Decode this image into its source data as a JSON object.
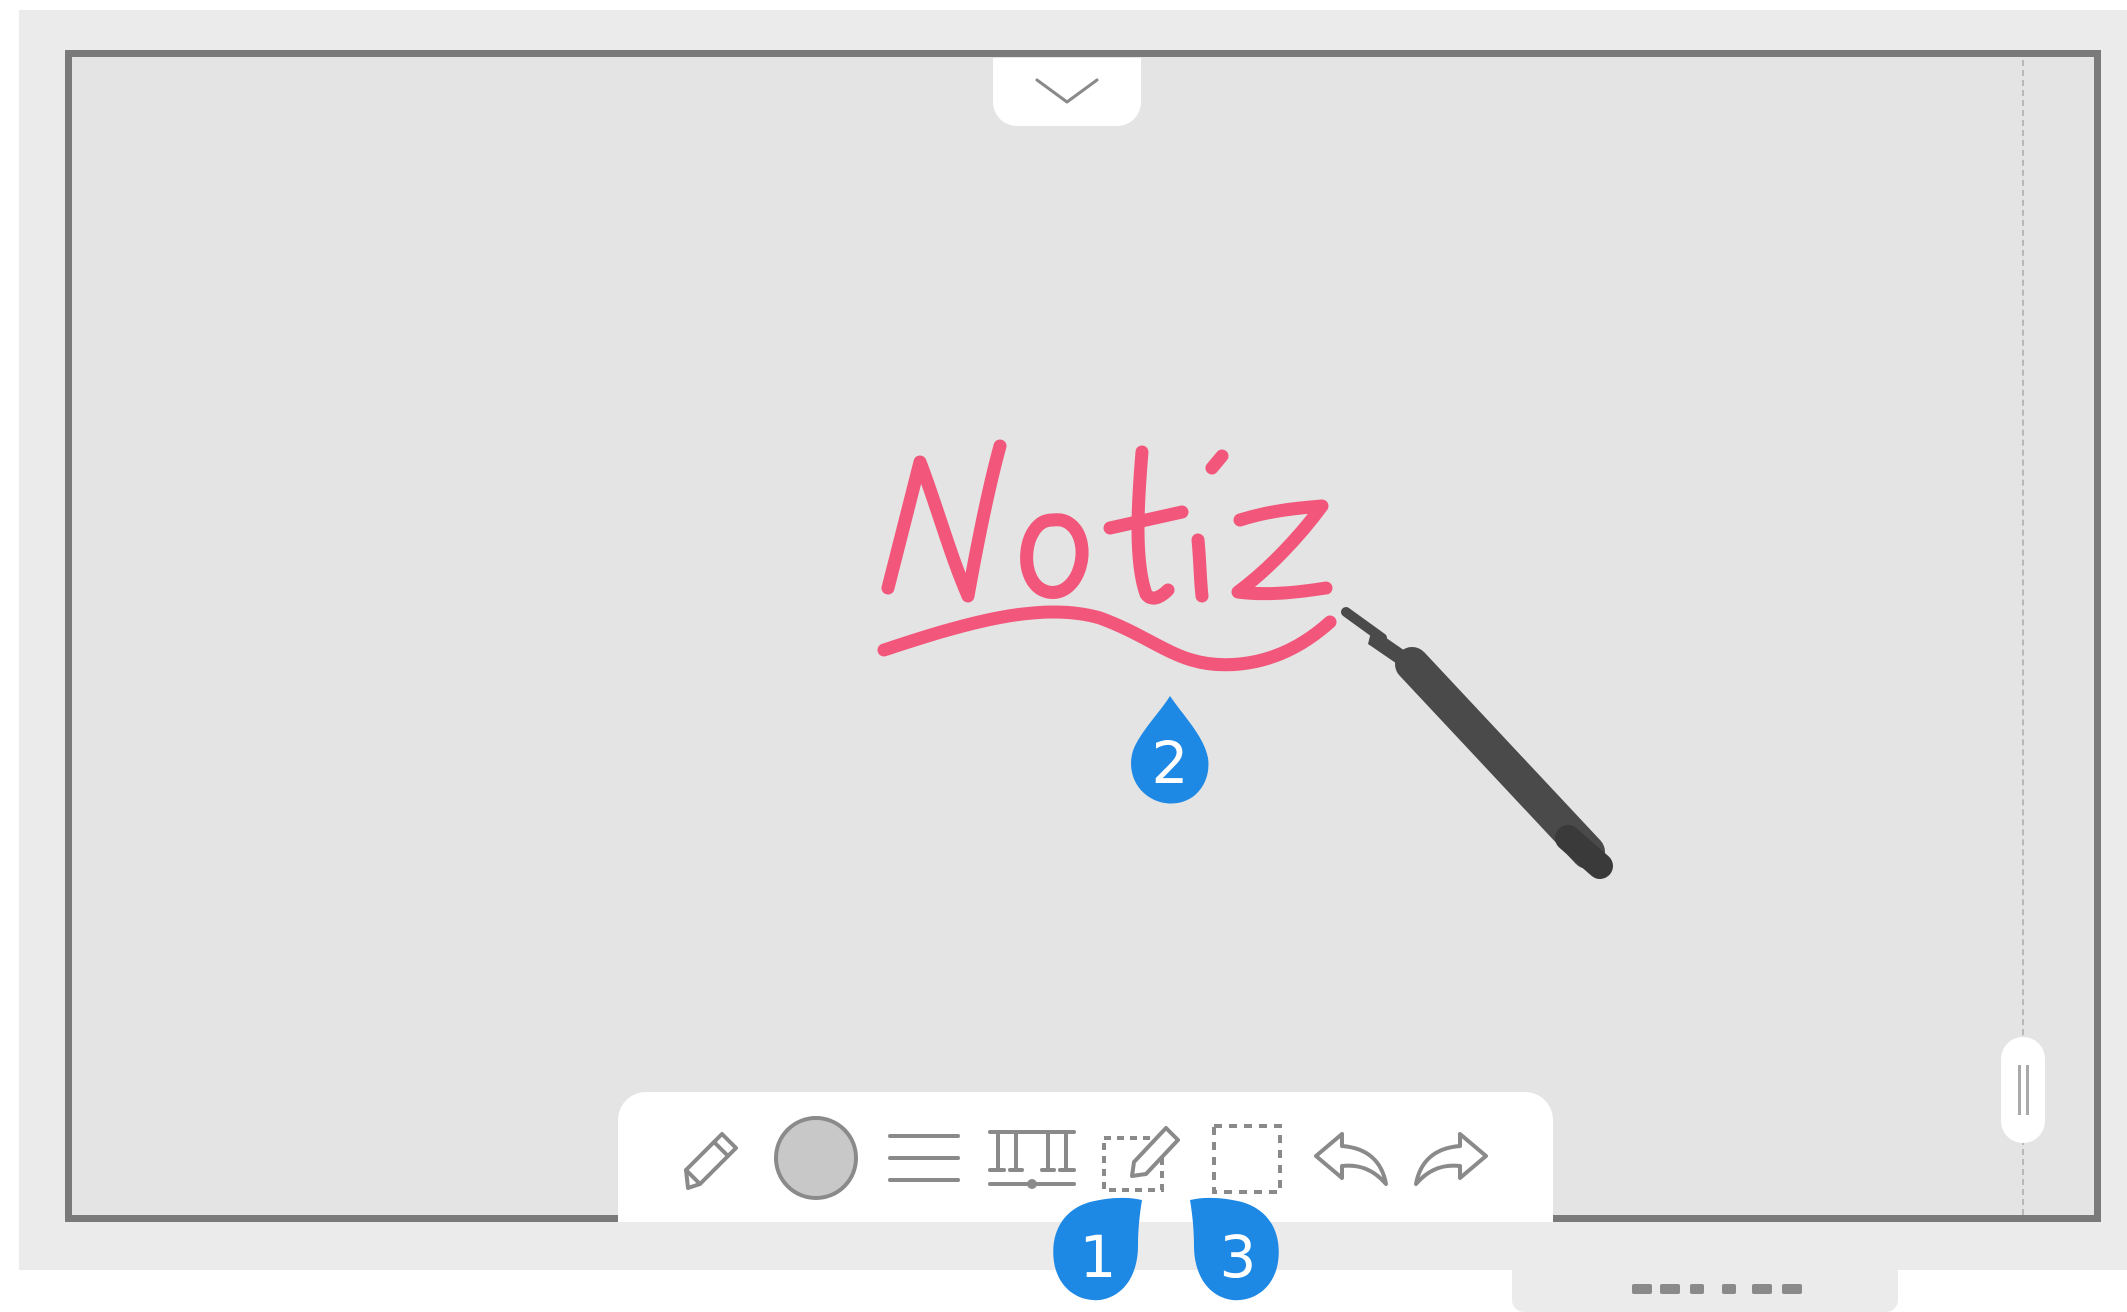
{
  "canvas": {
    "handwriting_text": "Notiz",
    "ink_color": "#f2567a"
  },
  "toolbar": {
    "tools": [
      {
        "name": "pen",
        "icon": "pencil-icon"
      },
      {
        "name": "color",
        "icon": "color-circle-icon"
      },
      {
        "name": "thickness",
        "icon": "line-thickness-icon"
      },
      {
        "name": "stroke-size",
        "icon": "stroke-size-icon"
      },
      {
        "name": "edit-selection",
        "icon": "edit-selection-icon"
      },
      {
        "name": "select",
        "icon": "selection-box-icon"
      },
      {
        "name": "undo",
        "icon": "undo-icon"
      },
      {
        "name": "redo",
        "icon": "redo-icon"
      }
    ]
  },
  "callouts": [
    {
      "label": "1",
      "color": "#1e88e5"
    },
    {
      "label": "2",
      "color": "#1e88e5"
    },
    {
      "label": "3",
      "color": "#1e88e5"
    }
  ],
  "colors": {
    "accent": "#1e88e5",
    "frame": "#7a7a7a",
    "board": "#e4e4e4",
    "icon": "#8a8a8a"
  }
}
